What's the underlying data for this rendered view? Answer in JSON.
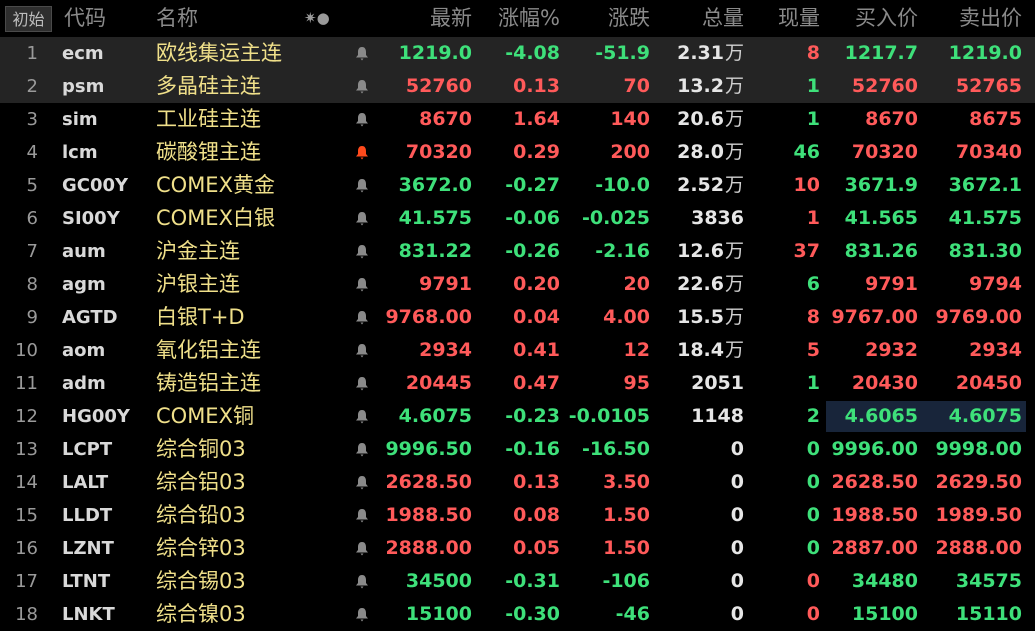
{
  "header": {
    "init_button": "初始",
    "columns": {
      "code": "代码",
      "name": "名称",
      "last": "最新",
      "change_pct": "涨幅%",
      "change": "涨跌",
      "volume": "总量",
      "current_vol": "现量",
      "bid": "买入价",
      "ask": "卖出价"
    },
    "icons_glyph": "✷●"
  },
  "colors": {
    "up": "#ff5a5a",
    "down": "#3ee07a",
    "name": "#f0e08a",
    "alert_bell": "#ff4a1c",
    "bell": "#8a8a8a"
  },
  "rows": [
    {
      "idx": "1",
      "code": "ecm",
      "name": "欧线集运主连",
      "last": "1219.0",
      "pct": "-4.08",
      "chg": "-51.9",
      "vol": "2.31",
      "vol_unit": "万",
      "cur": "8",
      "bid": "1217.7",
      "ask": "1219.0",
      "dir": "down",
      "cur_dir": "up",
      "bid_dir": "down",
      "ask_dir": "down",
      "bell": "gray"
    },
    {
      "idx": "2",
      "code": "psm",
      "name": "多晶硅主连",
      "last": "52760",
      "pct": "0.13",
      "chg": "70",
      "vol": "13.2",
      "vol_unit": "万",
      "cur": "1",
      "bid": "52760",
      "ask": "52765",
      "dir": "up",
      "cur_dir": "down",
      "bid_dir": "up",
      "ask_dir": "up",
      "bell": "gray"
    },
    {
      "idx": "3",
      "code": "sim",
      "name": "工业硅主连",
      "last": "8670",
      "pct": "1.64",
      "chg": "140",
      "vol": "20.6",
      "vol_unit": "万",
      "cur": "1",
      "bid": "8670",
      "ask": "8675",
      "dir": "up",
      "cur_dir": "down",
      "bid_dir": "up",
      "ask_dir": "up",
      "bell": "gray"
    },
    {
      "idx": "4",
      "code": "lcm",
      "name": "碳酸锂主连",
      "last": "70320",
      "pct": "0.29",
      "chg": "200",
      "vol": "28.0",
      "vol_unit": "万",
      "cur": "46",
      "bid": "70320",
      "ask": "70340",
      "dir": "up",
      "cur_dir": "down",
      "bid_dir": "up",
      "ask_dir": "up",
      "bell": "red"
    },
    {
      "idx": "5",
      "code": "GC00Y",
      "name": "COMEX黄金",
      "last": "3672.0",
      "pct": "-0.27",
      "chg": "-10.0",
      "vol": "2.52",
      "vol_unit": "万",
      "cur": "10",
      "bid": "3671.9",
      "ask": "3672.1",
      "dir": "down",
      "cur_dir": "up",
      "bid_dir": "down",
      "ask_dir": "down",
      "bell": "gray"
    },
    {
      "idx": "6",
      "code": "SI00Y",
      "name": "COMEX白银",
      "last": "41.575",
      "pct": "-0.06",
      "chg": "-0.025",
      "vol": "3836",
      "vol_unit": "",
      "cur": "1",
      "bid": "41.565",
      "ask": "41.575",
      "dir": "down",
      "cur_dir": "up",
      "bid_dir": "down",
      "ask_dir": "down",
      "bell": "gray"
    },
    {
      "idx": "7",
      "code": "aum",
      "name": "沪金主连",
      "last": "831.22",
      "pct": "-0.26",
      "chg": "-2.16",
      "vol": "12.6",
      "vol_unit": "万",
      "cur": "37",
      "bid": "831.26",
      "ask": "831.30",
      "dir": "down",
      "cur_dir": "up",
      "bid_dir": "down",
      "ask_dir": "down",
      "bell": "gray"
    },
    {
      "idx": "8",
      "code": "agm",
      "name": "沪银主连",
      "last": "9791",
      "pct": "0.20",
      "chg": "20",
      "vol": "22.6",
      "vol_unit": "万",
      "cur": "6",
      "bid": "9791",
      "ask": "9794",
      "dir": "up",
      "cur_dir": "down",
      "bid_dir": "up",
      "ask_dir": "up",
      "bell": "gray"
    },
    {
      "idx": "9",
      "code": "AGTD",
      "name": "白银T+D",
      "last": "9768.00",
      "pct": "0.04",
      "chg": "4.00",
      "vol": "15.5",
      "vol_unit": "万",
      "cur": "8",
      "bid": "9767.00",
      "ask": "9769.00",
      "dir": "up",
      "cur_dir": "up",
      "bid_dir": "up",
      "ask_dir": "up",
      "bell": "gray"
    },
    {
      "idx": "10",
      "code": "aom",
      "name": "氧化铝主连",
      "last": "2934",
      "pct": "0.41",
      "chg": "12",
      "vol": "18.4",
      "vol_unit": "万",
      "cur": "5",
      "bid": "2932",
      "ask": "2934",
      "dir": "up",
      "cur_dir": "up",
      "bid_dir": "up",
      "ask_dir": "up",
      "bell": "gray"
    },
    {
      "idx": "11",
      "code": "adm",
      "name": "铸造铝主连",
      "last": "20445",
      "pct": "0.47",
      "chg": "95",
      "vol": "2051",
      "vol_unit": "",
      "cur": "1",
      "bid": "20430",
      "ask": "20450",
      "dir": "up",
      "cur_dir": "down",
      "bid_dir": "up",
      "ask_dir": "up",
      "bell": "gray"
    },
    {
      "idx": "12",
      "code": "HG00Y",
      "name": "COMEX铜",
      "last": "4.6075",
      "pct": "-0.23",
      "chg": "-0.0105",
      "vol": "1148",
      "vol_unit": "",
      "cur": "2",
      "bid": "4.6065",
      "ask": "4.6075",
      "dir": "down",
      "cur_dir": "down",
      "bid_dir": "down",
      "ask_dir": "down",
      "bell": "gray"
    },
    {
      "idx": "13",
      "code": "LCPT",
      "name": "综合铜03",
      "last": "9996.50",
      "pct": "-0.16",
      "chg": "-16.50",
      "vol": "0",
      "vol_unit": "",
      "cur": "0",
      "bid": "9996.00",
      "ask": "9998.00",
      "dir": "down",
      "cur_dir": "down",
      "bid_dir": "down",
      "ask_dir": "down",
      "bell": "gray"
    },
    {
      "idx": "14",
      "code": "LALT",
      "name": "综合铝03",
      "last": "2628.50",
      "pct": "0.13",
      "chg": "3.50",
      "vol": "0",
      "vol_unit": "",
      "cur": "0",
      "bid": "2628.50",
      "ask": "2629.50",
      "dir": "up",
      "cur_dir": "down",
      "bid_dir": "up",
      "ask_dir": "up",
      "bell": "gray"
    },
    {
      "idx": "15",
      "code": "LLDT",
      "name": "综合铅03",
      "last": "1988.50",
      "pct": "0.08",
      "chg": "1.50",
      "vol": "0",
      "vol_unit": "",
      "cur": "0",
      "bid": "1988.50",
      "ask": "1989.50",
      "dir": "up",
      "cur_dir": "down",
      "bid_dir": "up",
      "ask_dir": "up",
      "bell": "gray"
    },
    {
      "idx": "16",
      "code": "LZNT",
      "name": "综合锌03",
      "last": "2888.00",
      "pct": "0.05",
      "chg": "1.50",
      "vol": "0",
      "vol_unit": "",
      "cur": "0",
      "bid": "2887.00",
      "ask": "2888.00",
      "dir": "up",
      "cur_dir": "down",
      "bid_dir": "up",
      "ask_dir": "up",
      "bell": "gray"
    },
    {
      "idx": "17",
      "code": "LTNT",
      "name": "综合锡03",
      "last": "34500",
      "pct": "-0.31",
      "chg": "-106",
      "vol": "0",
      "vol_unit": "",
      "cur": "0",
      "bid": "34480",
      "ask": "34575",
      "dir": "down",
      "cur_dir": "up",
      "bid_dir": "down",
      "ask_dir": "down",
      "bell": "gray"
    },
    {
      "idx": "18",
      "code": "LNKT",
      "name": "综合镍03",
      "last": "15100",
      "pct": "-0.30",
      "chg": "-46",
      "vol": "0",
      "vol_unit": "",
      "cur": "0",
      "bid": "15100",
      "ask": "15110",
      "dir": "down",
      "cur_dir": "up",
      "bid_dir": "down",
      "ask_dir": "down",
      "bell": "gray"
    }
  ]
}
